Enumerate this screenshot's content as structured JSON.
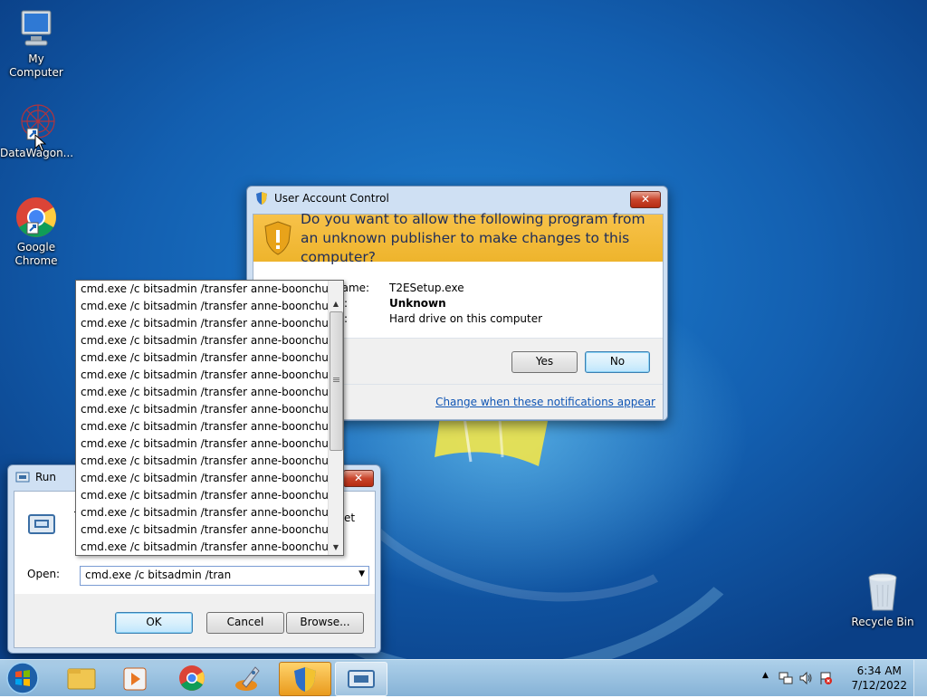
{
  "desktop": {
    "icons": [
      {
        "label": "My Computer",
        "icon": "computer-icon"
      },
      {
        "label": "DataWagon...",
        "icon": "datawagon-app-icon"
      },
      {
        "label": "Google Chrome",
        "icon": "chrome-icon"
      },
      {
        "label": "Recycle Bin",
        "icon": "recycle-bin-icon"
      }
    ]
  },
  "uac": {
    "title": "User Account Control",
    "close_label": "✕",
    "question": "Do you want to allow the following program from an unknown publisher to make changes to this computer?",
    "program_name_label": "name:",
    "program_name": "T2ESetup.exe",
    "publisher_label": ":",
    "publisher": "Unknown",
    "origin_label": ":",
    "origin": "Hard drive on this computer",
    "details_label": ":",
    "yes_label": "Yes",
    "no_label": "No",
    "notifications_link": "Change when these notifications appear",
    "banner_color": "#f3bb3a"
  },
  "run": {
    "title": "Run",
    "close_label": "✕",
    "description_line1": "T",
    "description_tail": "et",
    "description_line2": "n",
    "open_label": "Open:",
    "open_value": "cmd.exe /c bitsadmin /tran",
    "ok_label": "OK",
    "cancel_label": "Cancel",
    "browse_label": "Browse..."
  },
  "dropdown": {
    "items": [
      "cmd.exe /c bitsadmin /transfer anne-boonchuy /dov",
      "cmd.exe /c bitsadmin /transfer anne-boonchuy /dov",
      "cmd.exe /c bitsadmin /transfer anne-boonchuy /dov",
      "cmd.exe /c bitsadmin /transfer anne-boonchuy /dov",
      "cmd.exe /c bitsadmin /transfer anne-boonchuy /dov",
      "cmd.exe /c bitsadmin /transfer anne-boonchuy /dov",
      "cmd.exe /c bitsadmin /transfer anne-boonchuy /dov",
      "cmd.exe /c bitsadmin /transfer anne-boonchuy /dov",
      "cmd.exe /c bitsadmin /transfer anne-boonchuy /dov",
      "cmd.exe /c bitsadmin /transfer anne-boonchuy /dov",
      "cmd.exe /c bitsadmin /transfer anne-boonchuy /dov",
      "cmd.exe /c bitsadmin /transfer anne-boonchuy /dov",
      "cmd.exe /c bitsadmin /transfer anne-boonchuy /dov",
      "cmd.exe /c bitsadmin /transfer anne-boonchuy /dov",
      "cmd.exe /c bitsadmin /transfer anne-boonchuy /dov",
      "cmd.exe /c bitsadmin /transfer anne-boonchuy /dov"
    ]
  },
  "taskbar": {
    "buttons": [
      "start-orb-icon",
      "explorer-icon",
      "media-player-icon",
      "chrome-icon",
      "installer-rocket-icon",
      "uac-shield-icon",
      "run-dialog-icon"
    ],
    "tray_icons": [
      "show-hidden-icons",
      "network-icon",
      "volume-icon",
      "action-center-flag-icon"
    ],
    "time": "6:34 AM",
    "date": "7/12/2022"
  }
}
